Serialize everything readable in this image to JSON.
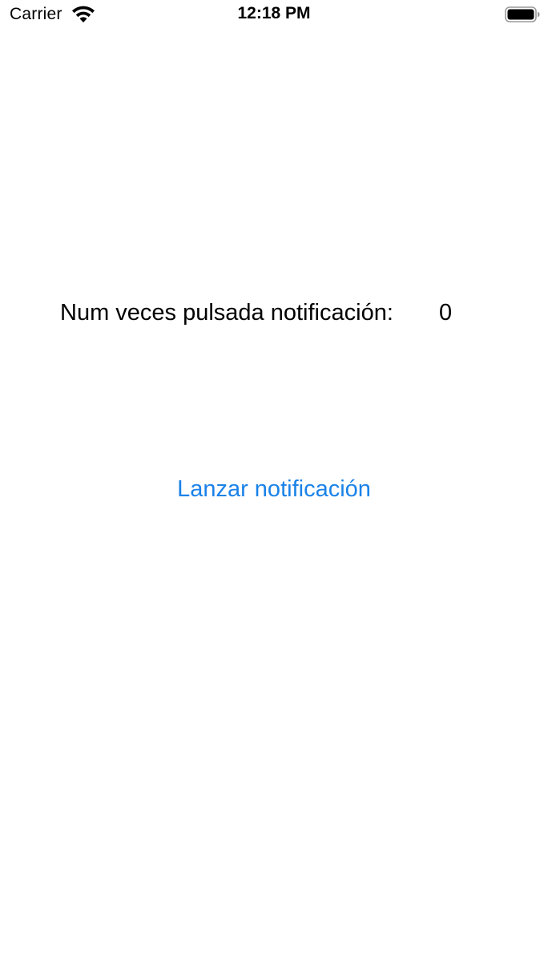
{
  "status_bar": {
    "carrier": "Carrier",
    "time": "12:18 PM",
    "wifi_icon": "wifi-icon",
    "battery_icon": "battery-icon",
    "battery_level": 1.0
  },
  "main": {
    "counter_label": "Num veces pulsada notificación:",
    "counter_value": "0",
    "launch_button_label": "Lanzar notificación",
    "accent_color": "#1a82e8"
  }
}
